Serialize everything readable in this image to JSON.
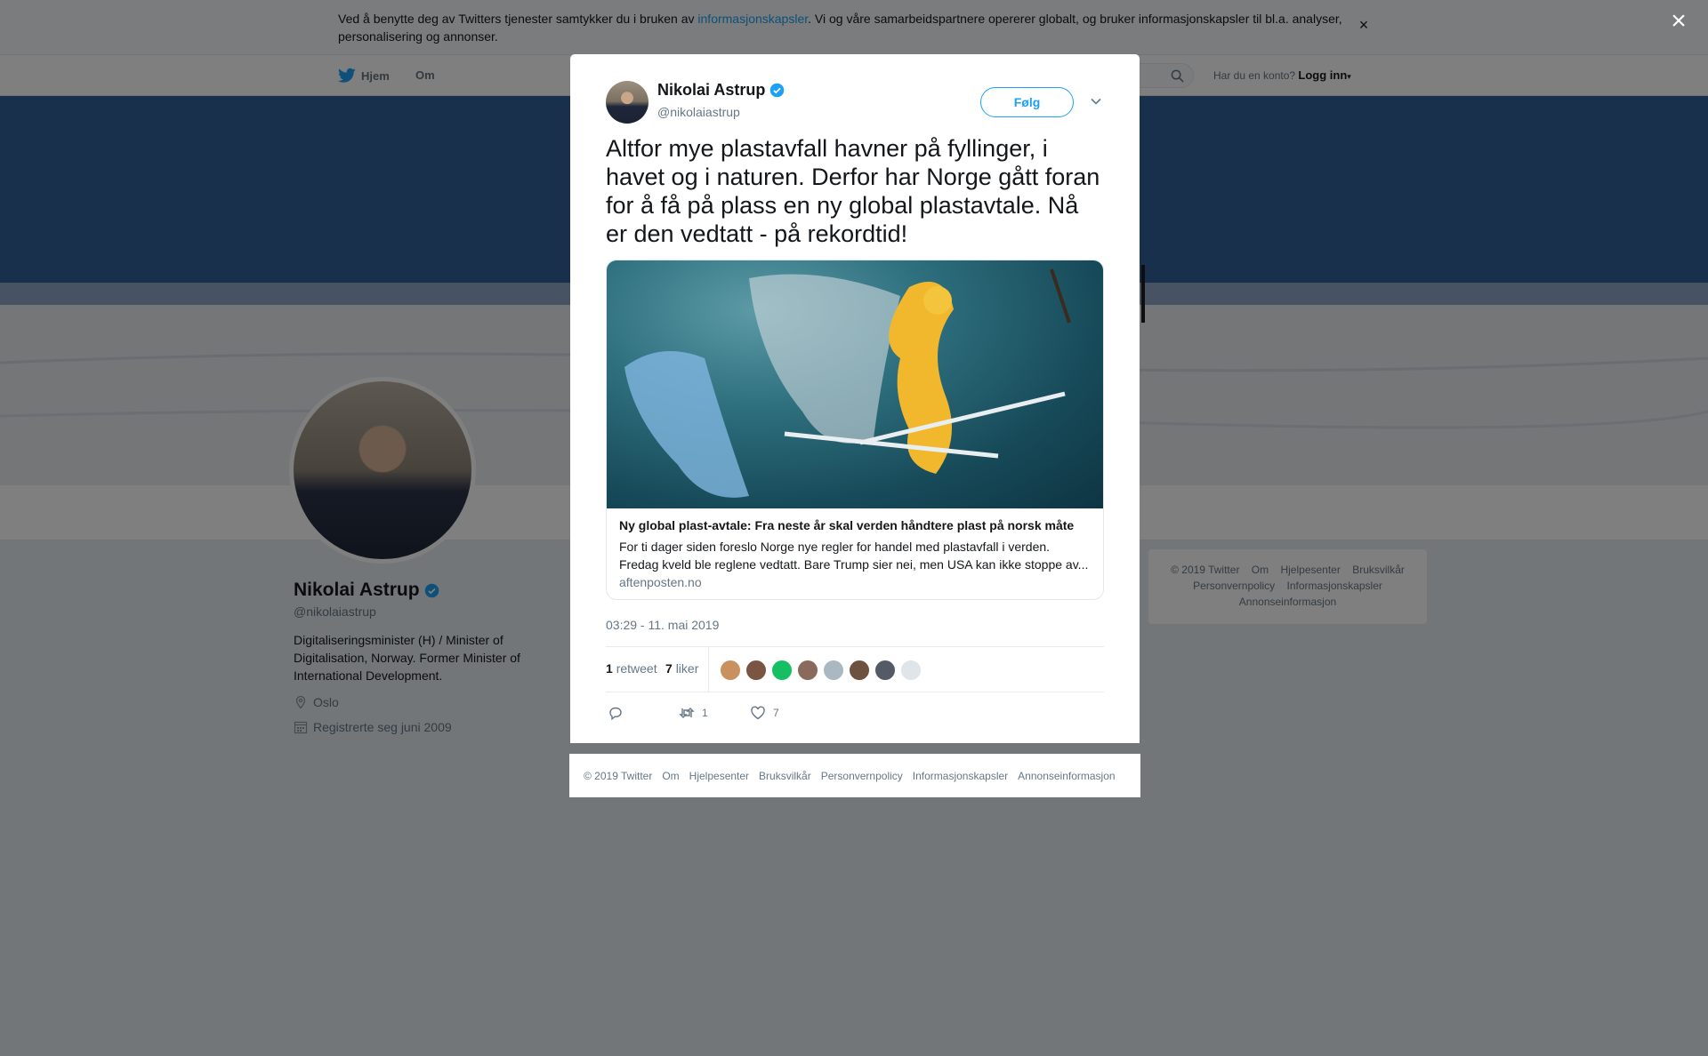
{
  "cookie_bar": {
    "text_before": "Ved å benytte deg av Twitters tjenester samtykker du i bruken av ",
    "link": "informasjonskapsler",
    "text_after": ". Vi og våre samarbeidspartnere opererer globalt, og bruker informasjonskapsler til bl.a. analyser, personalisering og annonser.",
    "close": "×"
  },
  "topnav": {
    "home": "Hjem",
    "about": "Om",
    "login_prompt": "Har du en konto?",
    "login_link": "Logg inn"
  },
  "profile": {
    "name": "Nikolai Astrup",
    "handle": "@nikolaiastrup",
    "bio": "Digitaliseringsminister (H) / Minister of Digitalisation, Norway. Former Minister of International Development.",
    "location": "Oslo",
    "joined": "Registrerte seg juni 2009"
  },
  "side_footer": {
    "links": [
      "© 2019 Twitter",
      "Om",
      "Hjelpesenter",
      "Bruksvilkår",
      "Personvernpolicy",
      "Informasjonskapsler",
      "Annonseinformasjon"
    ]
  },
  "overlay": {
    "close": "×"
  },
  "tweet": {
    "author_name": "Nikolai Astrup",
    "author_handle": "@nikolaiastrup",
    "follow_label": "Følg",
    "text": "Altfor mye plastavfall havner på fyllinger, i havet og i naturen. Derfor har Norge gått foran for å få på plass en ny global plastavtale. Nå er den vedtatt - på rekordtid!",
    "card": {
      "title": "Ny global plast-avtale: Fra neste år skal verden håndtere plast på norsk måte",
      "description": "For ti dager siden foreslo Norge nye regler for handel med plastavfall i verden. Fredag kveld ble reglene vedtatt. Bare Trump sier nei, men USA kan ikke stoppe av...",
      "domain": "aftenposten.no"
    },
    "timestamp": "03:29 - 11. mai 2019",
    "retweets_count": "1",
    "retweets_label": "retweet",
    "likes_count": "7",
    "likes_label": "liker",
    "action_retweets": "1",
    "action_likes": "7",
    "liker_avatar_colors": [
      "#c9915f",
      "#7b5544",
      "#17bf63",
      "#8a6a5c",
      "#aab8c2",
      "#6d5240",
      "#555b66",
      "#e0e5ea"
    ]
  },
  "modal_footer": {
    "links": [
      "© 2019 Twitter",
      "Om",
      "Hjelpesenter",
      "Bruksvilkår",
      "Personvernpolicy",
      "Informasjonskapsler",
      "Annonseinformasjon"
    ]
  },
  "colors": {
    "twitter_blue": "#1da1f2",
    "text_primary": "#14171a",
    "text_secondary": "#657786",
    "page_bg": "#e6ecf0"
  }
}
